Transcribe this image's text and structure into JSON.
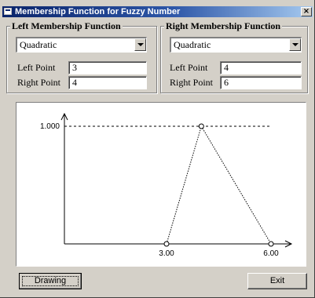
{
  "window": {
    "title": "Membership Function for Fuzzy Number",
    "close_label": "×"
  },
  "left_panel": {
    "legend": "Left Membership Function",
    "function_type": "Quadratic",
    "left_point_label": "Left Point",
    "left_point_value": "3",
    "right_point_label": "Right Point",
    "right_point_value": "4"
  },
  "right_panel": {
    "legend": "Right Membership Function",
    "function_type": "Quadratic",
    "left_point_label": "Left Point",
    "left_point_value": "4",
    "right_point_label": "Right Point",
    "right_point_value": "6"
  },
  "chart_data": {
    "type": "line",
    "title": "",
    "xlabel": "",
    "ylabel": "",
    "y_tick_labels": [
      "1.000"
    ],
    "x_tick_labels": [
      "3.00",
      "6.00"
    ],
    "xlim": [
      0,
      6.5
    ],
    "ylim": [
      0,
      1.1
    ],
    "series": [
      {
        "x": [
          3,
          4,
          6
        ],
        "y": [
          0,
          1,
          0
        ]
      }
    ],
    "reference_line": {
      "y": 1
    }
  },
  "buttons": {
    "drawing_label": "Drawing",
    "exit_label": "Exit"
  }
}
